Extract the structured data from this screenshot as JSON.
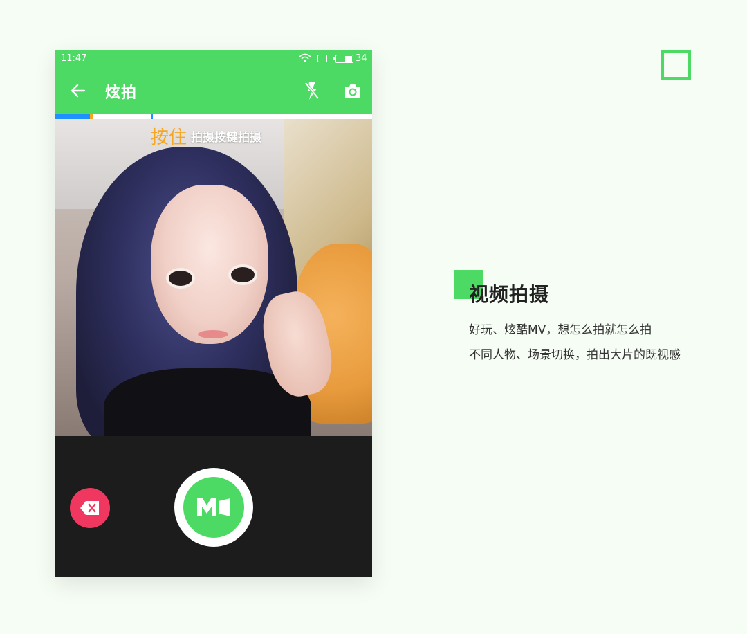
{
  "status_bar": {
    "time": "11:47",
    "battery_level": "34",
    "wifi_icon": "wifi-icon",
    "sim_icon": "sim-icon",
    "battery_icon": "battery-icon"
  },
  "toolbar": {
    "title": "炫拍",
    "back_icon": "arrow-left-icon",
    "flash_icon": "flash-off-icon",
    "camera_icon": "camera-icon"
  },
  "recording_progress": {
    "segments": 2
  },
  "viewfinder": {
    "hint_hold": "按住",
    "hint_text": "拍摄按键拍摄"
  },
  "controls": {
    "delete_icon": "backspace-icon",
    "record_icon": "mv-record-icon"
  },
  "feature": {
    "title": "视频拍摄",
    "line1": "好玩、炫酷MV，想怎么拍就怎么拍",
    "line2": "不同人物、场景切换，拍出大片的既视感"
  },
  "colors": {
    "brand_green": "#4cd964",
    "hint_orange": "#f5a623",
    "delete_red": "#f0375f",
    "progress_blue": "#1e90ff",
    "page_bg": "#f6fdf5"
  }
}
